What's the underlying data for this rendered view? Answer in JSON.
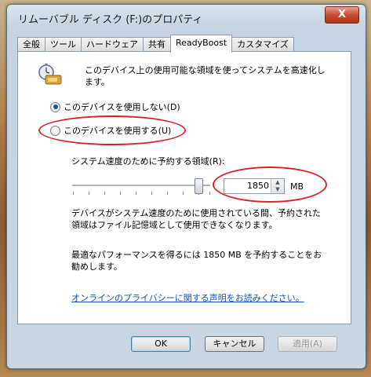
{
  "window": {
    "title": "リムーバブル ディスク (F:)のプロパティ",
    "close_glyph": "X"
  },
  "tabs": [
    {
      "label": "全般",
      "active": false
    },
    {
      "label": "ツール",
      "active": false
    },
    {
      "label": "ハードウェア",
      "active": false
    },
    {
      "label": "共有",
      "active": false
    },
    {
      "label": "ReadyBoost",
      "active": true
    },
    {
      "label": "カスタマイズ",
      "active": false
    }
  ],
  "readyboost": {
    "description": "このデバイス上の使用可能な領域を使ってシステムを高速化します。",
    "option_off_label": "このデバイスを使用しない(D)",
    "option_on_label": "このデバイスを使用する(U)",
    "selected_option": "off",
    "reserve_label": "システム速度のために予約する領域(R):",
    "slider_level": 0.9,
    "reserve_value": "1850",
    "reserve_unit": "MB",
    "note_usage": "デバイスがシステム速度のために使用されている間、予約された領域はファイル記憶域として使用できなくなります。",
    "note_recommend": "最適なパフォーマンスを得るには 1850 MB を予約することをお勧めします。",
    "privacy_link": "オンラインのプライバシーに関する声明をお読みください。"
  },
  "buttons": {
    "ok": "OK",
    "cancel": "キャンセル",
    "apply": "適用(A)"
  },
  "colors": {
    "highlight_oval": "#d8232a",
    "link": "#0a55b6"
  },
  "icons": {
    "drive": "usb-drive-stopwatch-icon"
  }
}
